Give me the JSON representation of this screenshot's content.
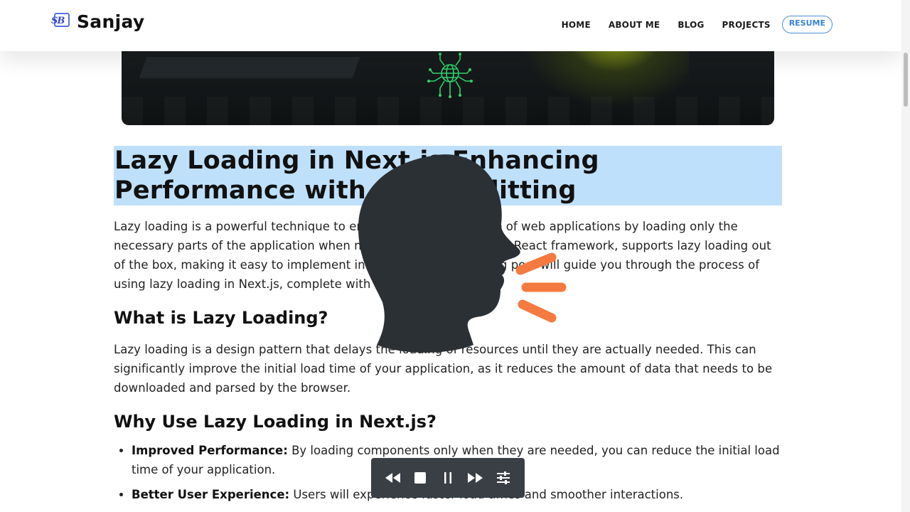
{
  "brand": {
    "logo_text": "SB",
    "name": "Sanjay"
  },
  "nav": {
    "items": [
      {
        "label": "HOME"
      },
      {
        "label": "ABOUT ME"
      },
      {
        "label": "BLOG"
      },
      {
        "label": "PROJECTS"
      }
    ],
    "resume_label": "RESUME"
  },
  "article": {
    "title": "Lazy Loading in Next.js Enhancing Performance with Code Splitting",
    "intro": "Lazy loading is a powerful technique to enhance the performance of web applications by loading only the necessary parts of the application when needed. Next.js, a popular React framework, supports lazy loading out of the box, making it easy to implement in your projects. This blog post will guide you through the process of using lazy loading in Next.js, complete with code examples.",
    "section1_heading": "What is Lazy Loading?",
    "section1_body": "Lazy loading is a design pattern that delays the loading of resources until they are actually needed. This can significantly improve the initial load time of your application, as it reduces the amount of data that needs to be downloaded and parsed by the browser.",
    "section2_heading": "Why Use Lazy Loading in Next.js?",
    "bullets": [
      {
        "term": "Improved Performance:",
        "text": " By loading components only when they are needed, you can reduce the initial load time of your application."
      },
      {
        "term": "Better User Experience:",
        "text": " Users will experience faster load times and smoother interactions."
      }
    ]
  },
  "colors": {
    "title_highlight": "#bfe0fb",
    "resume_accent": "#3a84d0",
    "speech_waves": "#f47a3f",
    "player_bg": "#3a3f46"
  },
  "icons": {
    "hero": "circuit-globe-icon",
    "overlay": "speaking-head-icon",
    "player": [
      "rewind-icon",
      "stop-icon",
      "pause-icon",
      "fast-forward-icon",
      "settings-sliders-icon"
    ]
  }
}
